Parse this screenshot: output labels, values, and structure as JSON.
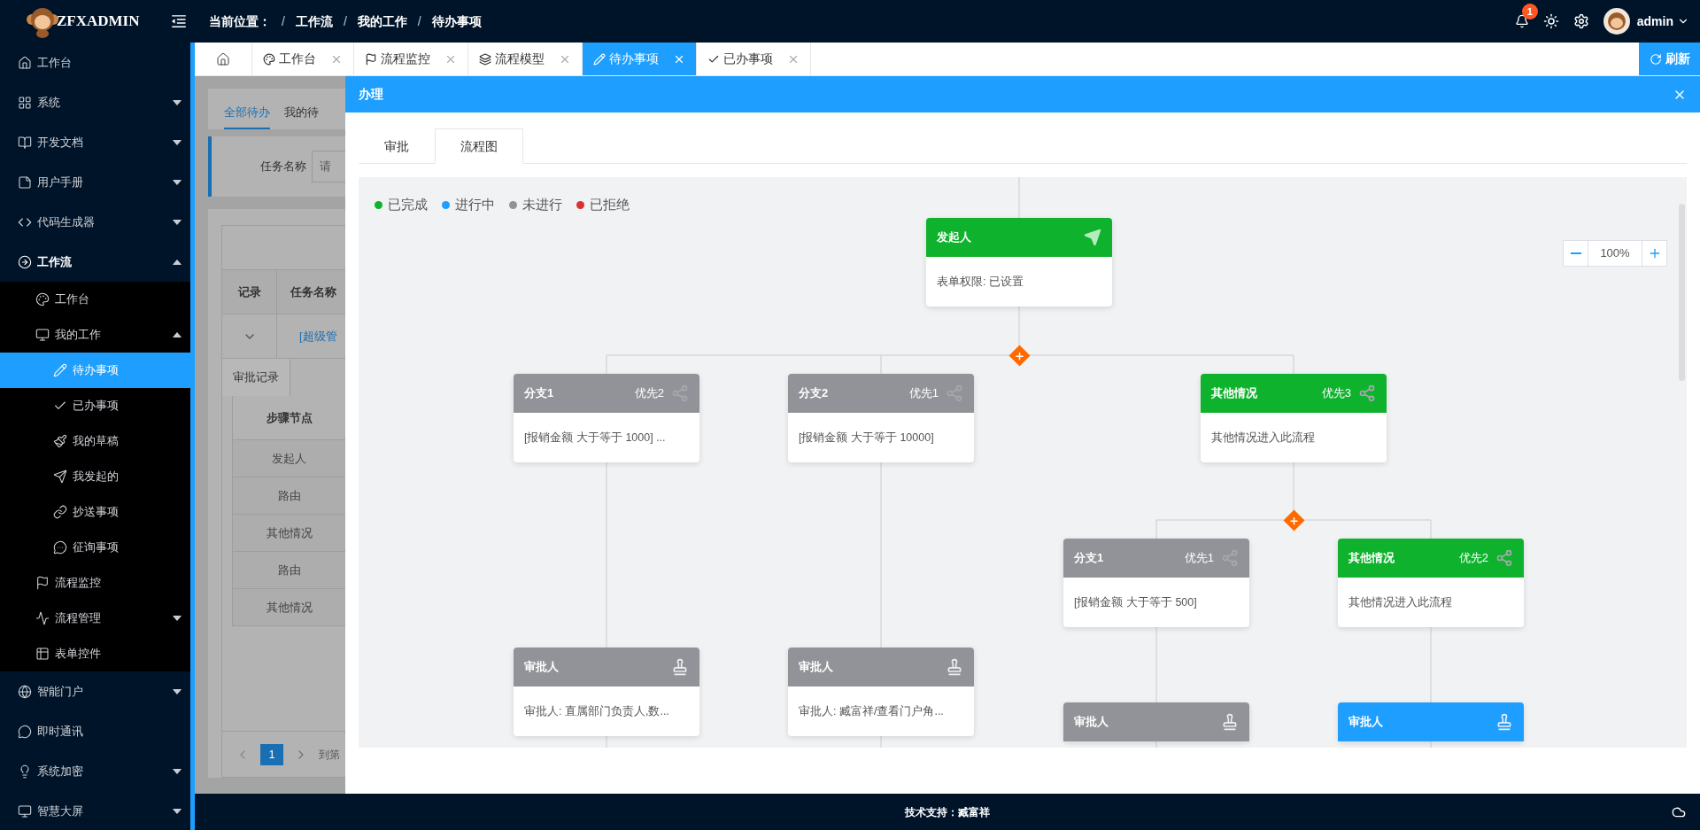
{
  "header": {
    "logo_text": "ZFXADMIN",
    "breadcrumb_label": "当前位置：",
    "separator": "/",
    "breadcrumb": [
      "工作流",
      "我的工作",
      "待办事项"
    ],
    "notification_count": "1",
    "user": "admin"
  },
  "sidebar": {
    "items": [
      {
        "label": "工作台",
        "selected": false
      },
      {
        "label": "系统",
        "selected": false,
        "expanded": false
      },
      {
        "label": "开发文档",
        "selected": false,
        "expanded": false
      },
      {
        "label": "用户手册",
        "selected": false,
        "expanded": false
      },
      {
        "label": "代码生成器",
        "selected": false,
        "expanded": false
      },
      {
        "label": "工作流",
        "selected": false,
        "expanded": true,
        "children": [
          {
            "label": "工作台",
            "selected": false
          },
          {
            "label": "我的工作",
            "selected": false,
            "expanded": true,
            "children": [
              {
                "label": "待办事项",
                "selected": true
              },
              {
                "label": "已办事项",
                "selected": false
              },
              {
                "label": "我的草稿",
                "selected": false
              },
              {
                "label": "我发起的",
                "selected": false
              },
              {
                "label": "抄送事项",
                "selected": false
              },
              {
                "label": "征询事项",
                "selected": false
              }
            ]
          },
          {
            "label": "流程监控",
            "selected": false
          },
          {
            "label": "流程管理",
            "selected": false,
            "expanded": false
          },
          {
            "label": "表单控件",
            "selected": false
          }
        ]
      },
      {
        "label": "智能门户",
        "selected": false,
        "expanded": false
      },
      {
        "label": "即时通讯",
        "selected": false
      },
      {
        "label": "系统加密",
        "selected": false,
        "expanded": false
      },
      {
        "label": "智慧大屏",
        "selected": false,
        "expanded": false
      }
    ]
  },
  "tabs": [
    {
      "kind": "home",
      "selected": false
    },
    {
      "kind": "page",
      "label": "工作台",
      "selected": false
    },
    {
      "kind": "page",
      "label": "流程监控",
      "selected": false
    },
    {
      "kind": "page",
      "label": "流程模型",
      "selected": false
    },
    {
      "kind": "page",
      "label": "待办事项",
      "selected": true
    },
    {
      "kind": "page",
      "label": "已办事项",
      "selected": false
    }
  ],
  "refresh_button": "刷新",
  "background": {
    "tabs": [
      {
        "label": "全部待办",
        "selected": true
      },
      {
        "label": "我的待",
        "selected": false
      }
    ],
    "search_label": "任务名称",
    "search_placeholder": "请",
    "columns": [
      "记录",
      "任务名称"
    ],
    "row_link": "[超级管",
    "detail_tab": "审批记录",
    "steps_column": "步骤节点",
    "steps": [
      "发起人",
      "路由",
      "其他情况",
      "路由",
      "其他情况"
    ],
    "page": "1",
    "goto_label": "到第"
  },
  "dialog": {
    "title": "办理",
    "tabs": [
      {
        "label": "审批",
        "selected": false
      },
      {
        "label": "流程图",
        "selected": true
      }
    ]
  },
  "flow": {
    "legend": [
      {
        "label": "已完成",
        "color": "#0fb22d"
      },
      {
        "label": "进行中",
        "color": "#1e9fff"
      },
      {
        "label": "未进行",
        "color": "#919398"
      },
      {
        "label": "已拒绝",
        "color": "#d9312f"
      }
    ],
    "zoom": "100%",
    "nodes": [
      {
        "kind": "starter",
        "color": "#0fb22d",
        "title": "发起人",
        "body": "表单权限: 已设置"
      },
      {
        "kind": "condition",
        "color": "#919398",
        "title": "分支1",
        "priority": "优先2",
        "body": "[报销金额 大于等于 1000] ..."
      },
      {
        "kind": "condition",
        "color": "#919398",
        "title": "分支2",
        "priority": "优先1",
        "body": "[报销金额 大于等于 10000]"
      },
      {
        "kind": "condition",
        "color": "#0fb22d",
        "title": "其他情况",
        "priority": "优先3",
        "body": "其他情况进入此流程"
      },
      {
        "kind": "condition",
        "color": "#919398",
        "title": "分支1",
        "priority": "优先1",
        "body": "[报销金额 大于等于 500]"
      },
      {
        "kind": "condition",
        "color": "#0fb22d",
        "title": "其他情况",
        "priority": "优先2",
        "body": "其他情况进入此流程"
      },
      {
        "kind": "approver",
        "color": "#919398",
        "title": "审批人",
        "body": "审批人: 直属部门负责人,数..."
      },
      {
        "kind": "approver",
        "color": "#919398",
        "title": "审批人",
        "body": "审批人: 臧富祥/查看门户角..."
      },
      {
        "kind": "approver",
        "color": "#919398",
        "title": "审批人"
      },
      {
        "kind": "approver",
        "color": "#1e9fff",
        "title": "审批人"
      }
    ]
  },
  "footer": "技术支持：臧富祥"
}
